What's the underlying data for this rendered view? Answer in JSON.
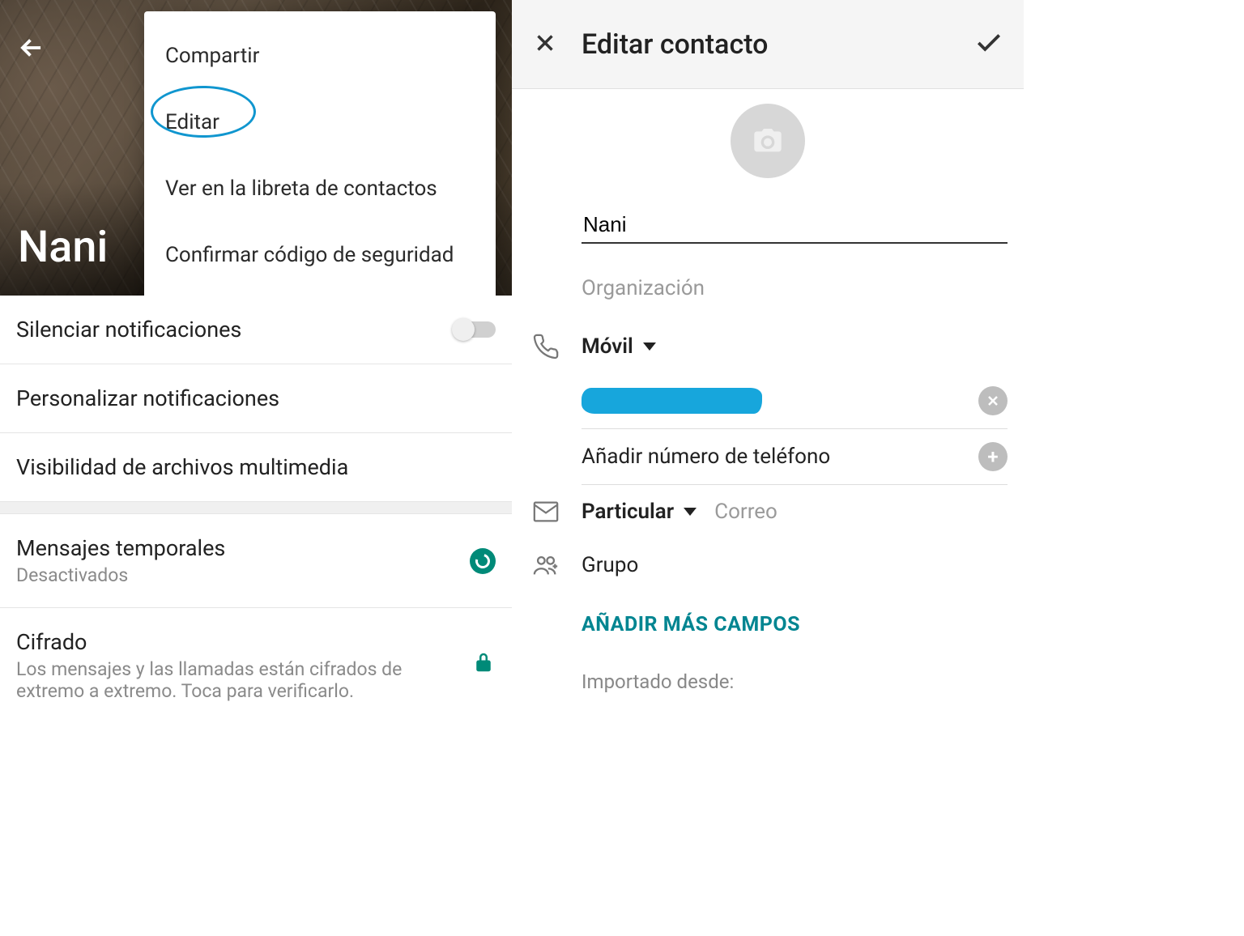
{
  "left": {
    "contact_name": "Nani",
    "menu": {
      "share": "Compartir",
      "edit": "Editar",
      "view_in_book": "Ver en la libreta de contactos",
      "verify_code": "Confirmar código de seguridad"
    },
    "settings": {
      "mute": "Silenciar notificaciones",
      "customize": "Personalizar notificaciones",
      "media_visibility": "Visibilidad de archivos multimedia",
      "disappearing": {
        "title": "Mensajes temporales",
        "status": "Desactivados"
      },
      "encryption": {
        "title": "Cifrado",
        "desc": "Los mensajes y las llamadas están cifrados de extremo a extremo. Toca para verificarlo."
      }
    }
  },
  "right": {
    "title": "Editar contacto",
    "name_value": "Nani",
    "org_placeholder": "Organización",
    "phone_type": "Móvil",
    "add_phone": "Añadir número de teléfono",
    "email_type": "Particular",
    "email_placeholder": "Correo",
    "group_label": "Grupo",
    "add_more": "AÑADIR MÁS CAMPOS",
    "imported_from": "Importado desde:"
  }
}
